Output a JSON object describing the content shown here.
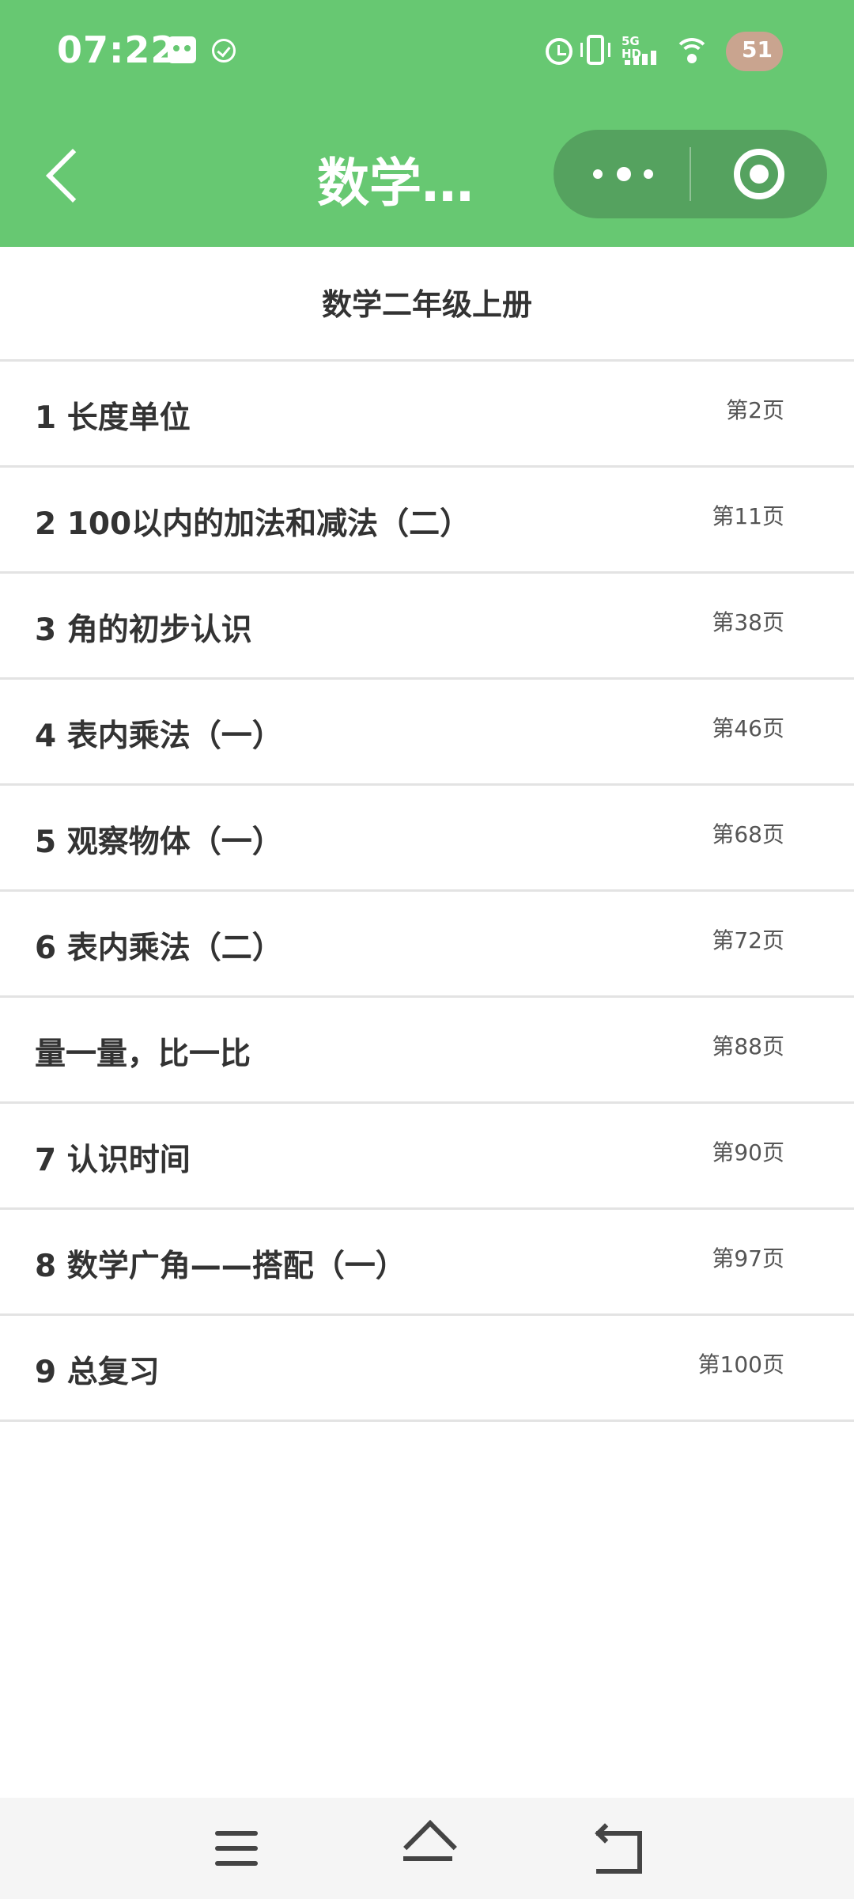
{
  "status_bar": {
    "time": "07:22",
    "network": "5G HD",
    "battery": "51"
  },
  "nav_bar": {
    "title": "数学…",
    "back_icon": "chevron-left-icon",
    "more_icon": "more-dots-icon",
    "close_icon": "target-circle-icon"
  },
  "book": {
    "title": "数学二年级上册"
  },
  "chapters": [
    {
      "title": "1 长度单位",
      "page": "第2页"
    },
    {
      "title": "2 100以内的加法和减法（二）",
      "page": "第11页"
    },
    {
      "title": "3 角的初步认识",
      "page": "第38页"
    },
    {
      "title": "4 表内乘法（一）",
      "page": "第46页"
    },
    {
      "title": "5 观察物体（一）",
      "page": "第68页"
    },
    {
      "title": "6 表内乘法（二）",
      "page": "第72页"
    },
    {
      "title": "量一量，比一比",
      "page": "第88页"
    },
    {
      "title": "7 认识时间",
      "page": "第90页"
    },
    {
      "title": "8 数学广角——搭配（一）",
      "page": "第97页"
    },
    {
      "title": "9 总复习",
      "page": "第100页"
    }
  ],
  "theme": {
    "header_color": "#67c872",
    "capsule_color": "#55a25f"
  }
}
